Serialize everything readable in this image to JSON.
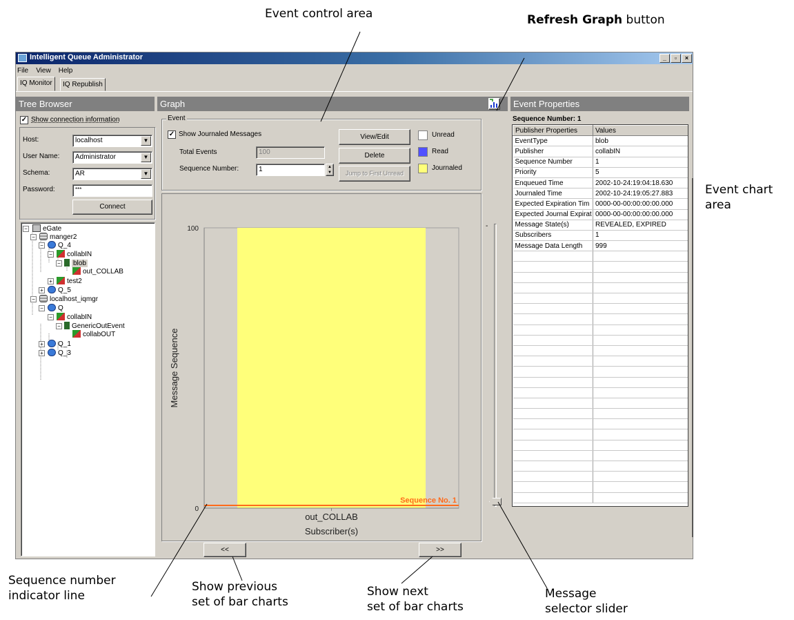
{
  "callouts": {
    "event_control_area": "Event control area",
    "refresh_graph_bold": "Refresh Graph",
    "refresh_graph_rest": " button",
    "event_chart_area_1": "Event chart",
    "event_chart_area_2": "area",
    "sequence_indicator_1": "Sequence number",
    "sequence_indicator_2": "indicator line",
    "show_previous_1": "Show previous",
    "show_previous_2": "set of bar charts",
    "show_next_1": "Show next",
    "show_next_2": "set of bar charts",
    "slider_1": "Message",
    "slider_2": "selector slider"
  },
  "window": {
    "title": "Intelligent Queue Administrator",
    "buttons": {
      "minimize": "_",
      "maximize": "▫",
      "close": "×"
    },
    "menu": [
      "File",
      "View",
      "Help"
    ],
    "tabs": [
      "IQ Monitor",
      "IQ Republish"
    ]
  },
  "tree_browser": {
    "header": "Tree Browser",
    "show_connection_label": "Show connection information",
    "show_connection_checked": true,
    "host_label": "Host:",
    "host_value": "localhost",
    "user_label": "User Name:",
    "user_value": "Administrator",
    "schema_label": "Schema:",
    "schema_value": "AR",
    "password_label": "Password:",
    "password_value": "***",
    "connect_label": "Connect",
    "tree": [
      {
        "label": "eGate",
        "icon": "registry-icon"
      },
      {
        "label": "manger2",
        "icon": "server-icon"
      },
      {
        "label": "Q_4",
        "icon": "queue-icon"
      },
      {
        "label": "collabIN",
        "icon": "collaboration-icon"
      },
      {
        "label": "blob",
        "icon": "event-type-icon"
      },
      {
        "label": "out_COLLAB",
        "icon": "collaboration-icon"
      },
      {
        "label": "test2",
        "icon": "collaboration-icon"
      },
      {
        "label": "Q_5",
        "icon": "queue-icon"
      },
      {
        "label": "localhost_iqmgr",
        "icon": "server-icon"
      },
      {
        "label": "Q",
        "icon": "queue-icon"
      },
      {
        "label": "collabIN",
        "icon": "collaboration-icon"
      },
      {
        "label": "GenericOutEvent",
        "icon": "event-type-icon"
      },
      {
        "label": "collabOUT",
        "icon": "collaboration-icon"
      },
      {
        "label": "Q_1",
        "icon": "queue-icon"
      },
      {
        "label": "Q_3",
        "icon": "queue-icon"
      }
    ]
  },
  "graph": {
    "header": "Graph",
    "event_group_label": "Event",
    "show_journaled_label": "Show Journaled Messages",
    "show_journaled_checked": true,
    "total_events_label": "Total Events",
    "total_events_value": "100",
    "sequence_number_label": "Sequence Number:",
    "sequence_number_value": "1",
    "view_edit_label": "View/Edit",
    "delete_label": "Delete",
    "jump_label": "Jump to First Unread",
    "legend": [
      {
        "label": "Unread",
        "color": "#ffffff"
      },
      {
        "label": "Read",
        "color": "#5050ff"
      },
      {
        "label": "Journaled",
        "color": "#ffff7a"
      }
    ],
    "prev_label": "<<",
    "next_label": ">>",
    "slider_min_mark": "-"
  },
  "chart_data": {
    "type": "bar",
    "categories": [
      "out_COLLAB"
    ],
    "series": [
      {
        "name": "Journaled",
        "values": [
          100
        ]
      }
    ],
    "ylim": [
      0,
      100
    ],
    "yticks": [
      "0",
      "100"
    ],
    "xlabel": "Subscriber(s)",
    "ylabel": "Message Sequence",
    "indicator_label": "Sequence No. 1",
    "indicator_value": 1,
    "colors": {
      "bar": "#ffff7a",
      "plot_bg": "#d4d0c8",
      "indicator": "#ff6a1a"
    }
  },
  "event_properties": {
    "header": "Event Properties",
    "sequence_title": "Sequence Number: 1",
    "columns": [
      "Publisher Properties",
      "Values"
    ],
    "rows": [
      [
        "EventType",
        "blob"
      ],
      [
        "Publisher",
        "collabIN"
      ],
      [
        "Sequence Number",
        "1"
      ],
      [
        "Priority",
        "5"
      ],
      [
        "Enqueued Time",
        "2002-10-24:19:04:18.630"
      ],
      [
        "Journaled Time",
        "2002-10-24:19:05:27.883"
      ],
      [
        "Expected Expiration Tim",
        "0000-00-00:00:00:00.000"
      ],
      [
        "Expected Journal Expirat",
        "0000-00-00:00:00:00.000"
      ],
      [
        "Message State(s)",
        "REVEALED, EXPIRED"
      ],
      [
        "Subscribers",
        "1"
      ],
      [
        "Message Data Length",
        "999"
      ]
    ]
  }
}
